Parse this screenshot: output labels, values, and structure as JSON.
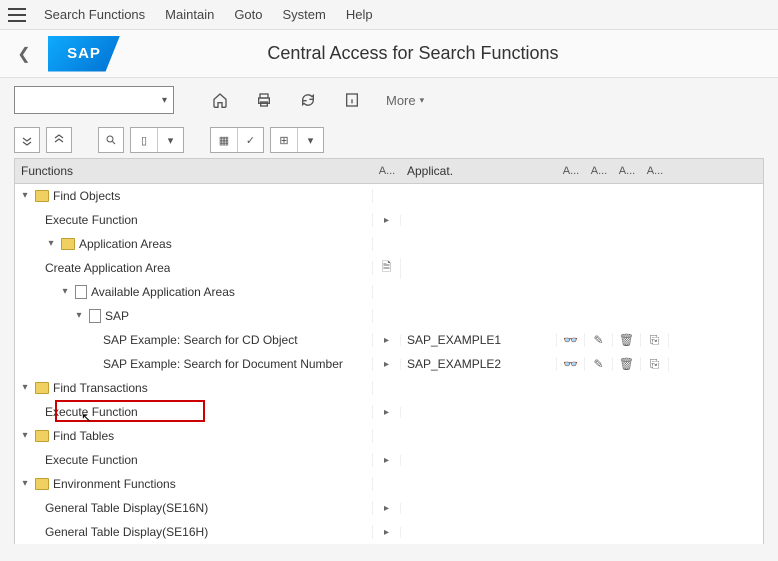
{
  "menu": {
    "items": [
      "Search Functions",
      "Maintain",
      "Goto",
      "System",
      "Help"
    ]
  },
  "title": "Central Access for Search Functions",
  "logo_text": "SAP",
  "toolbar": {
    "more": "More"
  },
  "table": {
    "header_functions": "Functions",
    "header_applicat": "Applicat.",
    "header_col1": "A...",
    "header_col2": "A...",
    "header_col3": "A...",
    "header_col4": "A...",
    "header_col5": "A..."
  },
  "tree": {
    "find_objects": "Find Objects",
    "exec_fn1": "Execute Function",
    "app_areas": "Application Areas",
    "create_app_area": "Create Application Area",
    "avail_app_areas": "Available Application Areas",
    "sap": "SAP",
    "sap_ex_cd": "SAP Example: Search for CD Object",
    "sap_ex_doc": "SAP Example: Search for Document Number",
    "find_trans": "Find Transactions",
    "exec_fn2": "Execute Function",
    "find_tables": "Find Tables",
    "exec_fn3": "Execute Function",
    "env_fn": "Environment Functions",
    "gen_tab1": "General Table Display(SE16N)",
    "gen_tab2": "General Table Display(SE16H)",
    "applicat1": "SAP_EXAMPLE1",
    "applicat2": "SAP_EXAMPLE2"
  }
}
